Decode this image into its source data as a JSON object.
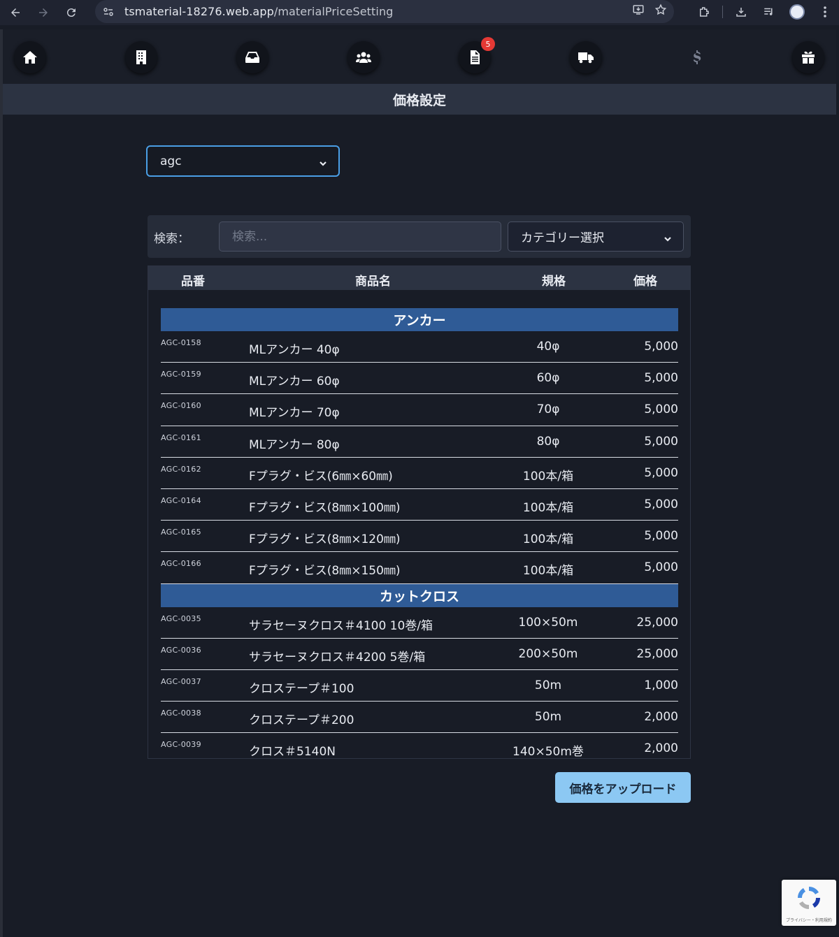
{
  "browser": {
    "url_host": "tsmaterial-18276.web.app",
    "url_path": "/materialPriceSetting"
  },
  "nav": {
    "items": [
      {
        "icon": "home-icon"
      },
      {
        "icon": "building-icon"
      },
      {
        "icon": "inbox-icon"
      },
      {
        "icon": "users-icon"
      },
      {
        "icon": "document-icon",
        "badge": "5"
      },
      {
        "icon": "truck-icon"
      },
      {
        "icon": "dollar-icon"
      },
      {
        "icon": "gift-icon"
      }
    ]
  },
  "page": {
    "title": "価格設定"
  },
  "supplier_select": {
    "value": "agc"
  },
  "filter": {
    "label": "検索：",
    "search_placeholder": "検索...",
    "category_placeholder": "カテゴリー選択"
  },
  "table": {
    "headers": {
      "code": "品番",
      "name": "商品名",
      "spec": "規格",
      "price": "価格"
    },
    "groups": [
      {
        "name": "アンカー",
        "rows": [
          {
            "code": "AGC-0158",
            "name": "MLアンカー 40φ",
            "spec": "40φ",
            "price": "5,000"
          },
          {
            "code": "AGC-0159",
            "name": "MLアンカー 60φ",
            "spec": "60φ",
            "price": "5,000"
          },
          {
            "code": "AGC-0160",
            "name": "MLアンカー 70φ",
            "spec": "70φ",
            "price": "5,000"
          },
          {
            "code": "AGC-0161",
            "name": "MLアンカー 80φ",
            "spec": "80φ",
            "price": "5,000"
          },
          {
            "code": "AGC-0162",
            "name": "Fプラグ・ビス(6㎜×60㎜)",
            "spec": "100本/箱",
            "price": "5,000"
          },
          {
            "code": "AGC-0164",
            "name": "Fプラグ・ビス(8㎜×100㎜)",
            "spec": "100本/箱",
            "price": "5,000"
          },
          {
            "code": "AGC-0165",
            "name": "Fプラグ・ビス(8㎜×120㎜)",
            "spec": "100本/箱",
            "price": "5,000"
          },
          {
            "code": "AGC-0166",
            "name": "Fプラグ・ビス(8㎜×150㎜)",
            "spec": "100本/箱",
            "price": "5,000"
          }
        ]
      },
      {
        "name": "カットクロス",
        "rows": [
          {
            "code": "AGC-0035",
            "name": "サラセーヌクロス＃4100 10巻/箱",
            "spec": "100×50m",
            "price": "25,000"
          },
          {
            "code": "AGC-0036",
            "name": "サラセーヌクロス＃4200 5巻/箱",
            "spec": "200×50m",
            "price": "25,000"
          },
          {
            "code": "AGC-0037",
            "name": "クロステープ＃100",
            "spec": "50m",
            "price": "1,000"
          },
          {
            "code": "AGC-0038",
            "name": "クロステープ＃200",
            "spec": "50m",
            "price": "2,000"
          },
          {
            "code": "AGC-0039",
            "name": "クロス＃5140N",
            "spec": "140×50m巻",
            "price": "2,000"
          }
        ]
      }
    ]
  },
  "upload_button": {
    "label": "価格をアップロード"
  },
  "recaptcha": {
    "text": "プライバシー・利用規約"
  },
  "colors": {
    "accent": "#4a9ee5",
    "group_header": "#2f5b96",
    "upload_button": "#8cc8f3",
    "badge": "#e53935"
  }
}
